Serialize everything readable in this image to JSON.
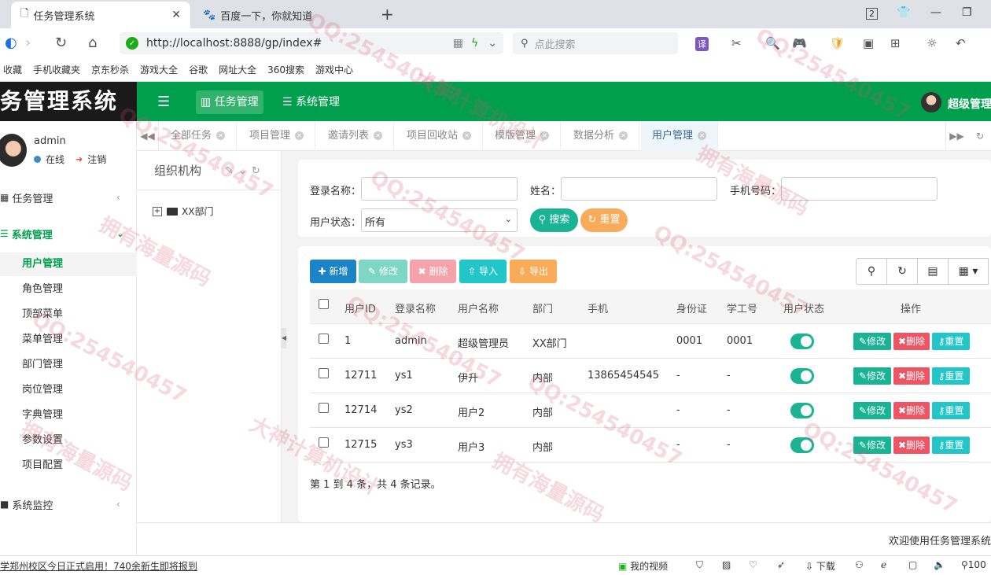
{
  "browser": {
    "tabs": [
      {
        "title": "任务管理系统",
        "active": true
      },
      {
        "title": "百度一下，你就知道",
        "active": false
      }
    ],
    "tab_count": "2",
    "url": "http://localhost:8888/gp/index#",
    "search_placeholder": "点此搜索",
    "translate_label": "译",
    "bookmarks": [
      "收藏",
      "手机收藏夹",
      "京东秒杀",
      "游戏大全",
      "谷歌",
      "网址大全",
      "360搜索",
      "游戏中心"
    ]
  },
  "app": {
    "logo_text": "务管理系统",
    "nav": [
      {
        "label": "任务管理",
        "icon": "bar-chart-icon",
        "active": true
      },
      {
        "label": "系统管理",
        "icon": "list-icon",
        "active": false
      }
    ],
    "user_name": "超级管理"
  },
  "sidebar": {
    "user": "admin",
    "status": "在线",
    "logout": "注销",
    "groups": [
      {
        "label": "任务管理",
        "open": false
      },
      {
        "label": "系统管理",
        "open": true
      },
      {
        "label": "系统监控",
        "open": false
      }
    ],
    "items": [
      "用户管理",
      "角色管理",
      "顶部菜单",
      "菜单管理",
      "部门管理",
      "岗位管理",
      "字典管理",
      "参数设置",
      "项目配置"
    ],
    "active_item": "用户管理"
  },
  "page_tabs": [
    "全部任务",
    "项目管理",
    "邀请列表",
    "项目回收站",
    "模版管理",
    "数据分析",
    "用户管理"
  ],
  "active_page_tab": "用户管理",
  "org": {
    "title": "组织机构",
    "root": "XX部门"
  },
  "search": {
    "login_label": "登录名称：",
    "name_label": "姓名：",
    "phone_label": "手机号码：",
    "status_label": "用户状态：",
    "status_value": "所有",
    "search_btn": "搜索",
    "reset_btn": "重置"
  },
  "toolbar": {
    "add": "新增",
    "edit": "修改",
    "delete": "删除",
    "import": "导入",
    "export": "导出"
  },
  "table": {
    "columns": [
      "用户ID",
      "登录名称",
      "用户名称",
      "部门",
      "手机",
      "身份证",
      "学工号",
      "用户状态",
      "操作"
    ],
    "rows": [
      {
        "id": "1",
        "login": "admin",
        "name": "超级管理员",
        "dept": "XX部门",
        "phone": "",
        "idcard": "0001",
        "sno": "0001",
        "enabled": true
      },
      {
        "id": "12711",
        "login": "ys1",
        "name": "伊升",
        "dept": "内部",
        "phone": "13865454545",
        "idcard": "-",
        "sno": "-",
        "enabled": true
      },
      {
        "id": "12714",
        "login": "ys2",
        "name": "用户2",
        "dept": "内部",
        "phone": "",
        "idcard": "-",
        "sno": "-",
        "enabled": true
      },
      {
        "id": "12715",
        "login": "ys3",
        "name": "用户3",
        "dept": "内部",
        "phone": "",
        "idcard": "-",
        "sno": "-",
        "enabled": true
      }
    ],
    "row_actions": {
      "edit": "修改",
      "delete": "删除",
      "reset": "重置"
    },
    "pagination": "第 1 到 4 条，共 4 条记录。"
  },
  "footer": "欢迎使用任务管理系统",
  "statusbar": {
    "news": "学郑州校区今日正式启用！740余新生即将报到",
    "video": "我的视频",
    "download": "下载",
    "zoom": "100"
  },
  "watermarks": [
    "QQ:254540457",
    "大神计算机设计",
    "拥有海量源码"
  ],
  "colors": {
    "primary": "#009f4d",
    "teal": "#1ab394",
    "cyan": "#23c6c8",
    "red": "#ed5565",
    "orange": "#f8ac59",
    "blue": "#1c84c6"
  }
}
